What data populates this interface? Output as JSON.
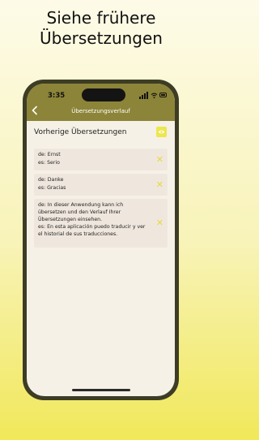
{
  "headline": {
    "line1": "Siehe frühere",
    "line2": "Übersetzungen"
  },
  "status_bar": {
    "time": "3:35"
  },
  "nav": {
    "title": "Übersetzungsverlauf",
    "back_icon": "chevron-left-icon"
  },
  "section": {
    "title": "Vorherige Übersetzungen",
    "action_icon": "eye-icon"
  },
  "history": [
    {
      "source": "de: Ernst",
      "target": "es: Serio"
    },
    {
      "source": "de: Danke",
      "target": "es: Gracias"
    },
    {
      "source_lines": [
        "de: In dieser Anwendung kann ich",
        "übersetzen und den Verlauf Ihrer",
        "Übersetzungen einsehen."
      ],
      "target_lines": [
        "es: En esta aplicación puedo traducir y ver",
        "el historial de sus traducciones."
      ]
    }
  ],
  "colors": {
    "accent": "#8c8438",
    "highlight": "#ece74d",
    "phone_frame": "#3d3c24",
    "card_bg": "#efe7de"
  }
}
